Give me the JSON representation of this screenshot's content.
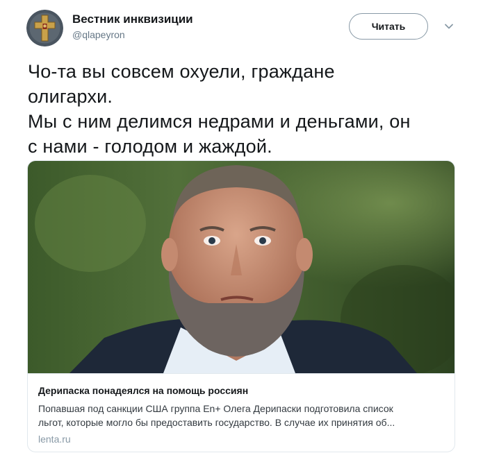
{
  "author": {
    "name": "Вестник инквизиции",
    "handle": "@qlapeyron"
  },
  "header": {
    "follow_label": "Читать",
    "menu_icon": "chevron-down-icon"
  },
  "tweet": {
    "lines": [
      "Чо-та вы совсем охуели, граждане",
      "олигархи.",
      "Мы с ним делимся недрами и деньгами, он",
      "с нами - голодом и жаждой."
    ]
  },
  "card": {
    "title": "Дерипаска понадеялся на помощь россиян",
    "description_lines": [
      "Попавшая под санкции США группа En+ Олега Дерипаски подготовила список",
      "льгот, которые могло бы предоставить государство. В случае их принятия об..."
    ],
    "domain": "lenta.ru"
  },
  "colors": {
    "text": "#14171a",
    "secondary": "#657786",
    "border": "#e1e8ed",
    "button_border": "#8899a6"
  }
}
